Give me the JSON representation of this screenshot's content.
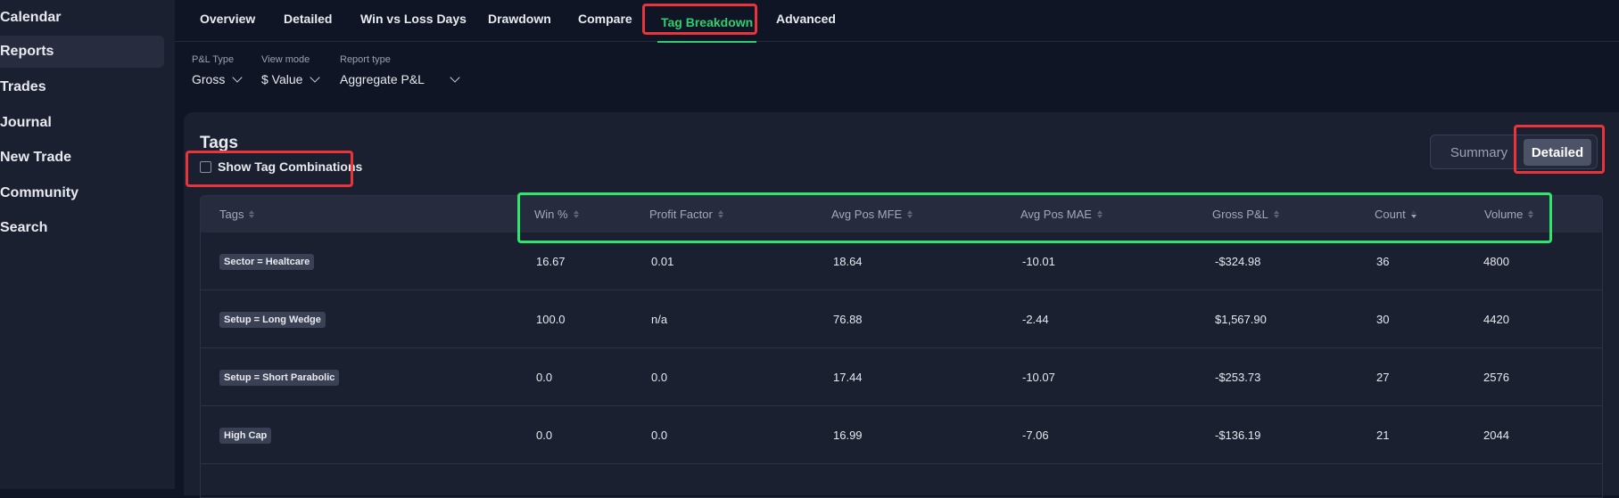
{
  "sidebar": {
    "items": [
      {
        "label": "Calendar",
        "active": false
      },
      {
        "label": "Reports",
        "active": true
      },
      {
        "label": "Trades",
        "active": false
      },
      {
        "label": "Journal",
        "active": false
      },
      {
        "label": "New Trade",
        "active": false
      },
      {
        "label": "Community",
        "active": false
      },
      {
        "label": "Search",
        "active": false
      }
    ]
  },
  "tabs": [
    {
      "label": "Overview",
      "active": false
    },
    {
      "label": "Detailed",
      "active": false
    },
    {
      "label": "Win vs Loss Days",
      "active": false
    },
    {
      "label": "Drawdown",
      "active": false
    },
    {
      "label": "Compare",
      "active": false
    },
    {
      "label": "Tag Breakdown",
      "active": true
    },
    {
      "label": "Advanced",
      "active": false
    }
  ],
  "filters": {
    "pl_type": {
      "label": "P&L Type",
      "value": "Gross"
    },
    "view_mode": {
      "label": "View mode",
      "value": "$ Value"
    },
    "report_type": {
      "label": "Report type",
      "value": "Aggregate P&L"
    }
  },
  "panel": {
    "title": "Tags",
    "show_combinations_label": "Show Tag Combinations",
    "show_combinations_checked": false,
    "view_toggle": {
      "summary": "Summary",
      "detailed": "Detailed",
      "selected": "Detailed"
    }
  },
  "table": {
    "columns": [
      "Tags",
      "Win %",
      "Profit Factor",
      "Avg Pos MFE",
      "Avg Pos MAE",
      "Gross P&L",
      "Count",
      "Volume"
    ],
    "sorted_column": "Count",
    "rows": [
      {
        "tag": "Sector = Healtcare",
        "win": "16.67",
        "pf": "0.01",
        "mfe": "18.64",
        "mae": "-10.01",
        "pnl": "-$324.98",
        "count": "36",
        "volume": "4800"
      },
      {
        "tag": "Setup = Long Wedge",
        "win": "100.0",
        "pf": "n/a",
        "mfe": "76.88",
        "mae": "-2.44",
        "pnl": "$1,567.90",
        "count": "30",
        "volume": "4420"
      },
      {
        "tag": "Setup = Short Parabolic",
        "win": "0.0",
        "pf": "0.0",
        "mfe": "17.44",
        "mae": "-10.07",
        "pnl": "-$253.73",
        "count": "27",
        "volume": "2576"
      },
      {
        "tag": "High Cap",
        "win": "0.0",
        "pf": "0.0",
        "mfe": "16.99",
        "mae": "-7.06",
        "pnl": "-$136.19",
        "count": "21",
        "volume": "2044"
      }
    ]
  },
  "colors": {
    "accent_green": "#2fcf6f",
    "highlight_red": "#e8343a",
    "highlight_green": "#2ee66b"
  }
}
